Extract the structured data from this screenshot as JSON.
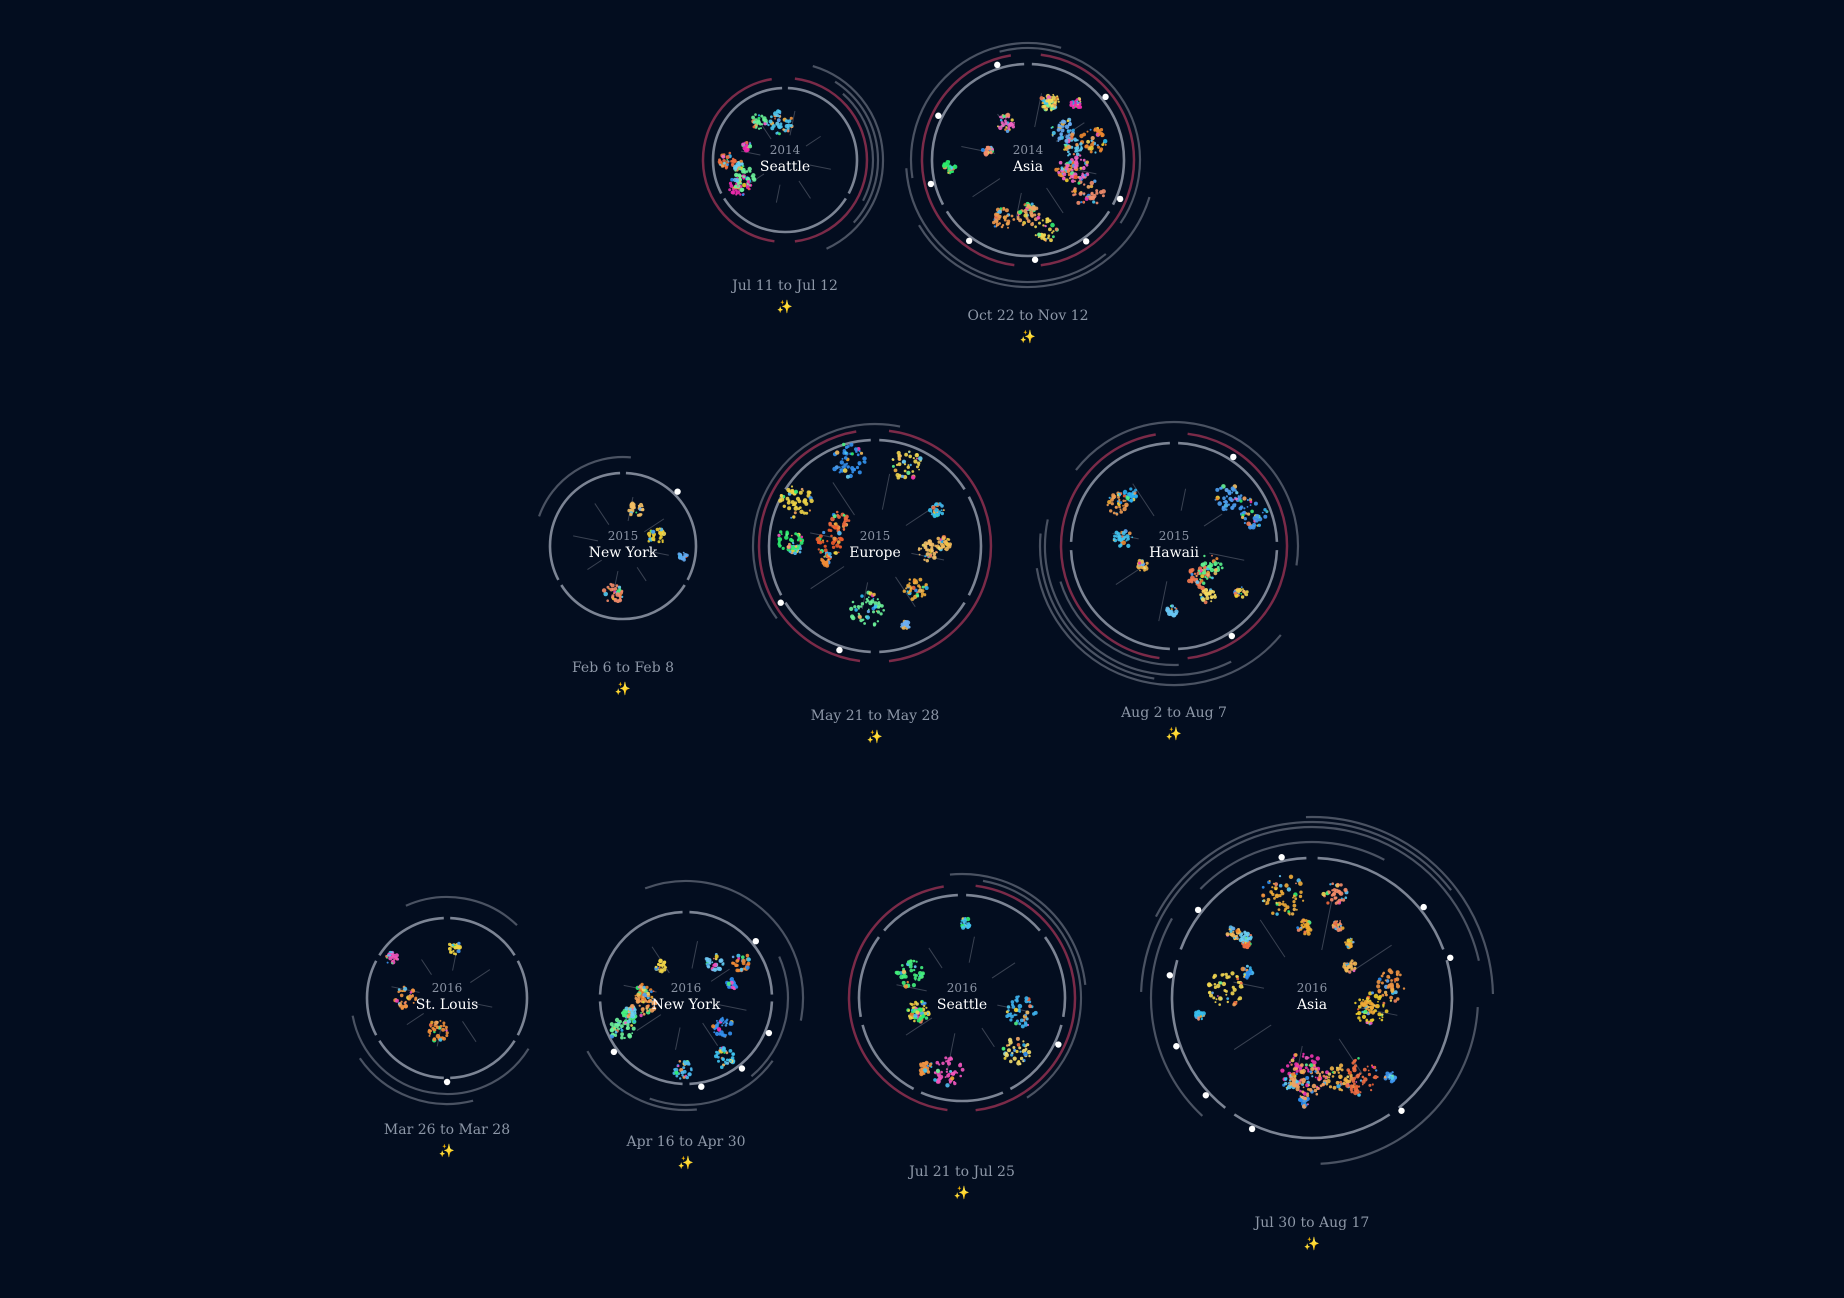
{
  "colors": {
    "background": "#030d1f",
    "ring": "#7c8494",
    "ring_dim": "#4a5262",
    "accent_ring": "#7a2a48",
    "sparkle": "#e0b040",
    "label": "#8d97a7"
  },
  "sparkle_glyph": "✨",
  "trips": [
    {
      "year": "2014",
      "place": "Seattle",
      "date_range": "Jul 11 to Jul 12"
    },
    {
      "year": "2014",
      "place": "Asia",
      "date_range": "Oct 22 to Nov 12"
    },
    {
      "year": "2015",
      "place": "New York",
      "date_range": "Feb 6 to Feb 8"
    },
    {
      "year": "2015",
      "place": "Europe",
      "date_range": "May 21 to May 28"
    },
    {
      "year": "2015",
      "place": "Hawaii",
      "date_range": "Aug 2 to Aug 7"
    },
    {
      "year": "2016",
      "place": "St. Louis",
      "date_range": "Mar 26 to Mar 28"
    },
    {
      "year": "2016",
      "place": "New York",
      "date_range": "Apr 16 to Apr 30"
    },
    {
      "year": "2016",
      "place": "Seattle",
      "date_range": "Jul 21 to Jul 25"
    },
    {
      "year": "2016",
      "place": "Asia",
      "date_range": "Jul 30 to Aug 17"
    }
  ]
}
